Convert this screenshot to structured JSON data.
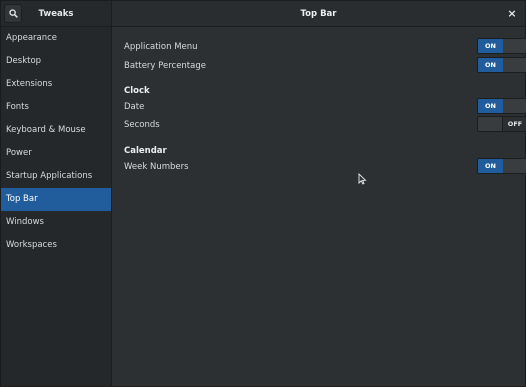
{
  "header": {
    "app_title": "Tweaks",
    "page_title": "Top Bar",
    "close_glyph": "×",
    "search_icon": "search-icon"
  },
  "sidebar": {
    "items": [
      {
        "label": "Appearance",
        "selected": false
      },
      {
        "label": "Desktop",
        "selected": false
      },
      {
        "label": "Extensions",
        "selected": false
      },
      {
        "label": "Fonts",
        "selected": false
      },
      {
        "label": "Keyboard & Mouse",
        "selected": false
      },
      {
        "label": "Power",
        "selected": false
      },
      {
        "label": "Startup Applications",
        "selected": false
      },
      {
        "label": "Top Bar",
        "selected": true
      },
      {
        "label": "Windows",
        "selected": false
      },
      {
        "label": "Workspaces",
        "selected": false
      }
    ]
  },
  "settings": {
    "application_menu": {
      "label": "Application Menu",
      "state": "ON"
    },
    "battery_percentage": {
      "label": "Battery Percentage",
      "state": "ON"
    },
    "clock": {
      "heading": "Clock",
      "date": {
        "label": "Date",
        "state": "ON"
      },
      "seconds": {
        "label": "Seconds",
        "state": "OFF"
      }
    },
    "calendar": {
      "heading": "Calendar",
      "week_numbers": {
        "label": "Week Numbers",
        "state": "ON"
      }
    }
  },
  "colors": {
    "accent": "#215d9c",
    "background": "#2d3033",
    "sidebar": "#25282a"
  }
}
